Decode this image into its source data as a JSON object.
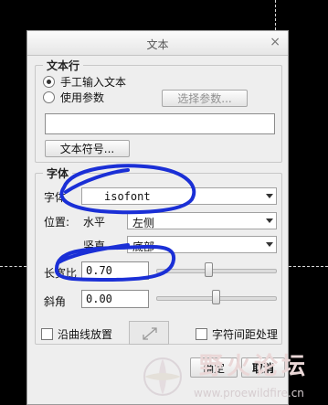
{
  "dialog": {
    "title": "文本",
    "close_glyph": "×"
  },
  "text_row": {
    "legend": "文本行",
    "manual_label": "手工输入文本",
    "param_label": "使用参数",
    "select_param_button": "选择参数...",
    "text_value": "",
    "symbol_button": "文本符号..."
  },
  "font_group": {
    "legend": "字体",
    "font_label": "字体",
    "font_value": "isofont",
    "position_label": "位置:",
    "horizontal_label": "水平",
    "horizontal_value": "左侧",
    "vertical_label": "竖直",
    "vertical_value": "底部",
    "ratio_label": "长宽比",
    "ratio_value": "0.70",
    "ratio_slider": 0.44,
    "angle_label": "斜角",
    "angle_value": "0.00",
    "angle_slider": 0.5
  },
  "options": {
    "along_curve_label": "沿曲线放置",
    "char_spacing_label": "字符间距处理"
  },
  "footer": {
    "ok_label": "确定",
    "cancel_label": "取消"
  },
  "watermark": {
    "brand": "野火论坛",
    "url": "www.proewildfire.cn"
  }
}
